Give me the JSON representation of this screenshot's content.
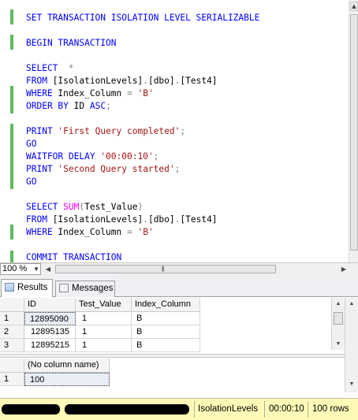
{
  "editor": {
    "lines": [
      [
        {
          "t": "SET TRANSACTION ISOLATION LEVEL SERIALIZABLE",
          "c": "kw"
        }
      ],
      [
        {
          "t": "BEGIN TRANSACTION",
          "c": "kw"
        }
      ],
      [
        {
          "t": "SELECT  ",
          "c": "kw"
        },
        {
          "t": "*",
          "c": "gray"
        }
      ],
      [
        {
          "t": "FROM ",
          "c": "kw"
        },
        {
          "t": "[IsolationLevels]",
          "c": "plain"
        },
        {
          "t": ".",
          "c": "gray"
        },
        {
          "t": "[dbo]",
          "c": "plain"
        },
        {
          "t": ".",
          "c": "gray"
        },
        {
          "t": "[Test4]",
          "c": "plain"
        }
      ],
      [
        {
          "t": "WHERE ",
          "c": "kw"
        },
        {
          "t": "Index_Column ",
          "c": "plain"
        },
        {
          "t": "= ",
          "c": "gray"
        },
        {
          "t": "'B'",
          "c": "str"
        }
      ],
      [
        {
          "t": "ORDER BY ",
          "c": "kw"
        },
        {
          "t": "ID ",
          "c": "plain"
        },
        {
          "t": "ASC",
          "c": "kw"
        },
        {
          "t": ";",
          "c": "gray"
        }
      ],
      [
        {
          "t": "PRINT ",
          "c": "kw"
        },
        {
          "t": "'First Query completed'",
          "c": "str"
        },
        {
          "t": ";",
          "c": "gray"
        }
      ],
      [
        {
          "t": "GO",
          "c": "kw"
        }
      ],
      [
        {
          "t": "WAITFOR DELAY ",
          "c": "kw"
        },
        {
          "t": "'00:00:10'",
          "c": "str"
        },
        {
          "t": ";",
          "c": "gray"
        }
      ],
      [
        {
          "t": "PRINT ",
          "c": "kw"
        },
        {
          "t": "'Second Query started'",
          "c": "str"
        },
        {
          "t": ";",
          "c": "gray"
        }
      ],
      [
        {
          "t": "GO",
          "c": "kw"
        }
      ],
      [
        {
          "t": "SELECT ",
          "c": "kw"
        },
        {
          "t": "SUM",
          "c": "fn"
        },
        {
          "t": "(",
          "c": "gray"
        },
        {
          "t": "Test_Value",
          "c": "plain"
        },
        {
          "t": ")",
          "c": "gray"
        }
      ],
      [
        {
          "t": "FROM ",
          "c": "kw"
        },
        {
          "t": "[IsolationLevels]",
          "c": "plain"
        },
        {
          "t": ".",
          "c": "gray"
        },
        {
          "t": "[dbo]",
          "c": "plain"
        },
        {
          "t": ".",
          "c": "gray"
        },
        {
          "t": "[Test4]",
          "c": "plain"
        }
      ],
      [
        {
          "t": "WHERE ",
          "c": "kw"
        },
        {
          "t": "Index_Column ",
          "c": "plain"
        },
        {
          "t": "= ",
          "c": "gray"
        },
        {
          "t": "'B'",
          "c": "str"
        }
      ],
      [
        {
          "t": "COMMIT TRANSACTION",
          "c": "kw"
        }
      ]
    ]
  },
  "zoom": {
    "value": "100 %"
  },
  "tabs": {
    "results": "Results",
    "messages": "Messages"
  },
  "grid1": {
    "columns": [
      "ID",
      "Test_Value",
      "Index_Column"
    ],
    "rows": [
      {
        "num": "1",
        "cells": [
          "12895090",
          "1",
          "B"
        ]
      },
      {
        "num": "2",
        "cells": [
          "12895135",
          "1",
          "B"
        ]
      },
      {
        "num": "3",
        "cells": [
          "12895215",
          "1",
          "B"
        ]
      }
    ]
  },
  "grid2": {
    "columns": [
      "(No column name)"
    ],
    "rows": [
      {
        "num": "1",
        "cells": [
          "100"
        ]
      }
    ]
  },
  "status": {
    "database": "IsolationLevels",
    "elapsed": "00:00:10",
    "rows": "100 rows"
  },
  "colors": {
    "keyword": "#0000ff",
    "string": "#a31515",
    "function": "#ff00ff",
    "operator": "#808080",
    "change_bar": "#5fb95f",
    "status_bg": "#fff9b8"
  }
}
